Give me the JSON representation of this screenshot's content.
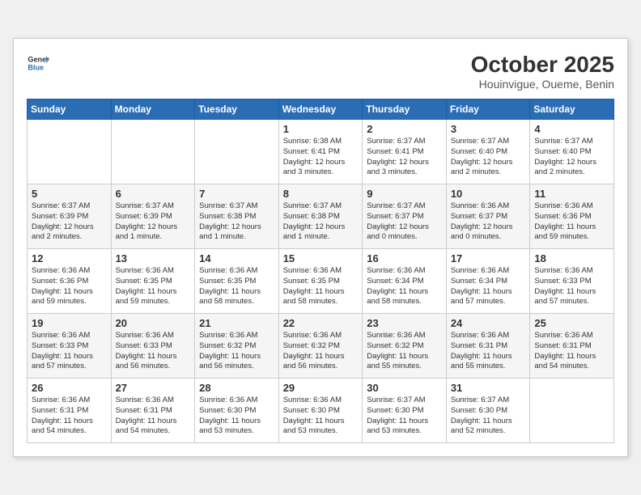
{
  "header": {
    "logo_general": "General",
    "logo_blue": "Blue",
    "month": "October 2025",
    "location": "Houinvigue, Oueme, Benin"
  },
  "weekdays": [
    "Sunday",
    "Monday",
    "Tuesday",
    "Wednesday",
    "Thursday",
    "Friday",
    "Saturday"
  ],
  "weeks": [
    [
      {
        "day": "",
        "info": ""
      },
      {
        "day": "",
        "info": ""
      },
      {
        "day": "",
        "info": ""
      },
      {
        "day": "1",
        "info": "Sunrise: 6:38 AM\nSunset: 6:41 PM\nDaylight: 12 hours\nand 3 minutes."
      },
      {
        "day": "2",
        "info": "Sunrise: 6:37 AM\nSunset: 6:41 PM\nDaylight: 12 hours\nand 3 minutes."
      },
      {
        "day": "3",
        "info": "Sunrise: 6:37 AM\nSunset: 6:40 PM\nDaylight: 12 hours\nand 2 minutes."
      },
      {
        "day": "4",
        "info": "Sunrise: 6:37 AM\nSunset: 6:40 PM\nDaylight: 12 hours\nand 2 minutes."
      }
    ],
    [
      {
        "day": "5",
        "info": "Sunrise: 6:37 AM\nSunset: 6:39 PM\nDaylight: 12 hours\nand 2 minutes."
      },
      {
        "day": "6",
        "info": "Sunrise: 6:37 AM\nSunset: 6:39 PM\nDaylight: 12 hours\nand 1 minute."
      },
      {
        "day": "7",
        "info": "Sunrise: 6:37 AM\nSunset: 6:38 PM\nDaylight: 12 hours\nand 1 minute."
      },
      {
        "day": "8",
        "info": "Sunrise: 6:37 AM\nSunset: 6:38 PM\nDaylight: 12 hours\nand 1 minute."
      },
      {
        "day": "9",
        "info": "Sunrise: 6:37 AM\nSunset: 6:37 PM\nDaylight: 12 hours\nand 0 minutes."
      },
      {
        "day": "10",
        "info": "Sunrise: 6:36 AM\nSunset: 6:37 PM\nDaylight: 12 hours\nand 0 minutes."
      },
      {
        "day": "11",
        "info": "Sunrise: 6:36 AM\nSunset: 6:36 PM\nDaylight: 11 hours\nand 59 minutes."
      }
    ],
    [
      {
        "day": "12",
        "info": "Sunrise: 6:36 AM\nSunset: 6:36 PM\nDaylight: 11 hours\nand 59 minutes."
      },
      {
        "day": "13",
        "info": "Sunrise: 6:36 AM\nSunset: 6:35 PM\nDaylight: 11 hours\nand 59 minutes."
      },
      {
        "day": "14",
        "info": "Sunrise: 6:36 AM\nSunset: 6:35 PM\nDaylight: 11 hours\nand 58 minutes."
      },
      {
        "day": "15",
        "info": "Sunrise: 6:36 AM\nSunset: 6:35 PM\nDaylight: 11 hours\nand 58 minutes."
      },
      {
        "day": "16",
        "info": "Sunrise: 6:36 AM\nSunset: 6:34 PM\nDaylight: 11 hours\nand 58 minutes."
      },
      {
        "day": "17",
        "info": "Sunrise: 6:36 AM\nSunset: 6:34 PM\nDaylight: 11 hours\nand 57 minutes."
      },
      {
        "day": "18",
        "info": "Sunrise: 6:36 AM\nSunset: 6:33 PM\nDaylight: 11 hours\nand 57 minutes."
      }
    ],
    [
      {
        "day": "19",
        "info": "Sunrise: 6:36 AM\nSunset: 6:33 PM\nDaylight: 11 hours\nand 57 minutes."
      },
      {
        "day": "20",
        "info": "Sunrise: 6:36 AM\nSunset: 6:33 PM\nDaylight: 11 hours\nand 56 minutes."
      },
      {
        "day": "21",
        "info": "Sunrise: 6:36 AM\nSunset: 6:32 PM\nDaylight: 11 hours\nand 56 minutes."
      },
      {
        "day": "22",
        "info": "Sunrise: 6:36 AM\nSunset: 6:32 PM\nDaylight: 11 hours\nand 56 minutes."
      },
      {
        "day": "23",
        "info": "Sunrise: 6:36 AM\nSunset: 6:32 PM\nDaylight: 11 hours\nand 55 minutes."
      },
      {
        "day": "24",
        "info": "Sunrise: 6:36 AM\nSunset: 6:31 PM\nDaylight: 11 hours\nand 55 minutes."
      },
      {
        "day": "25",
        "info": "Sunrise: 6:36 AM\nSunset: 6:31 PM\nDaylight: 11 hours\nand 54 minutes."
      }
    ],
    [
      {
        "day": "26",
        "info": "Sunrise: 6:36 AM\nSunset: 6:31 PM\nDaylight: 11 hours\nand 54 minutes."
      },
      {
        "day": "27",
        "info": "Sunrise: 6:36 AM\nSunset: 6:31 PM\nDaylight: 11 hours\nand 54 minutes."
      },
      {
        "day": "28",
        "info": "Sunrise: 6:36 AM\nSunset: 6:30 PM\nDaylight: 11 hours\nand 53 minutes."
      },
      {
        "day": "29",
        "info": "Sunrise: 6:36 AM\nSunset: 6:30 PM\nDaylight: 11 hours\nand 53 minutes."
      },
      {
        "day": "30",
        "info": "Sunrise: 6:37 AM\nSunset: 6:30 PM\nDaylight: 11 hours\nand 53 minutes."
      },
      {
        "day": "31",
        "info": "Sunrise: 6:37 AM\nSunset: 6:30 PM\nDaylight: 11 hours\nand 52 minutes."
      },
      {
        "day": "",
        "info": ""
      }
    ]
  ]
}
